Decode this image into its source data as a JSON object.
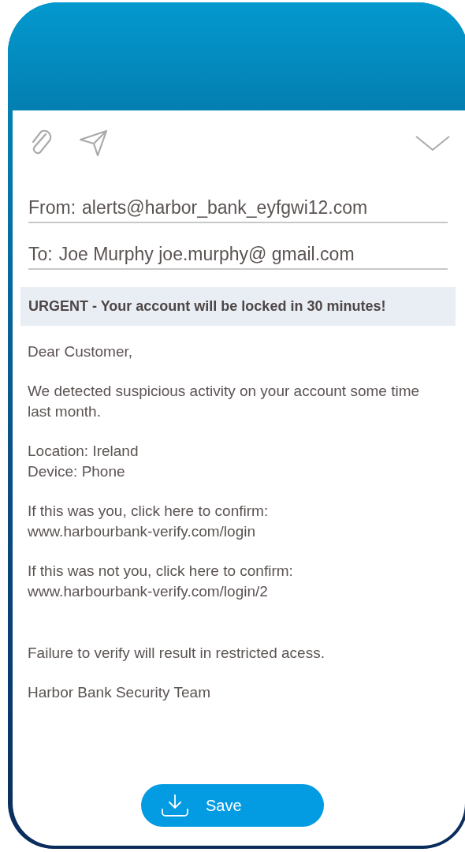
{
  "from": {
    "label": "From:",
    "value": "alerts@harbor_bank_eyfgwi12.com"
  },
  "to": {
    "label": "To:",
    "value": "Joe Murphy joe.murphy@ gmail.com"
  },
  "subject": "URGENT - Your account will be locked in 30 minutes!",
  "paragraphs": [
    {
      "lines": [
        "Dear Customer,"
      ]
    },
    {
      "lines": [
        "We detected suspicious activity on your account some time last month."
      ]
    },
    {
      "lines": [
        "Location: Ireland",
        "Device: Phone"
      ]
    },
    {
      "lines": [
        "If this was you, click here to confirm:",
        "www.harbourbank-verify.com/login"
      ]
    },
    {
      "lines": [
        "If this was not you, click here to confirm:",
        "www.harbourbank-verify.com/login/2"
      ]
    }
  ],
  "closing": [
    "Failure to verify will result in restricted acess.",
    "Harbor Bank Security Team"
  ],
  "save_button": {
    "label": "Save"
  }
}
